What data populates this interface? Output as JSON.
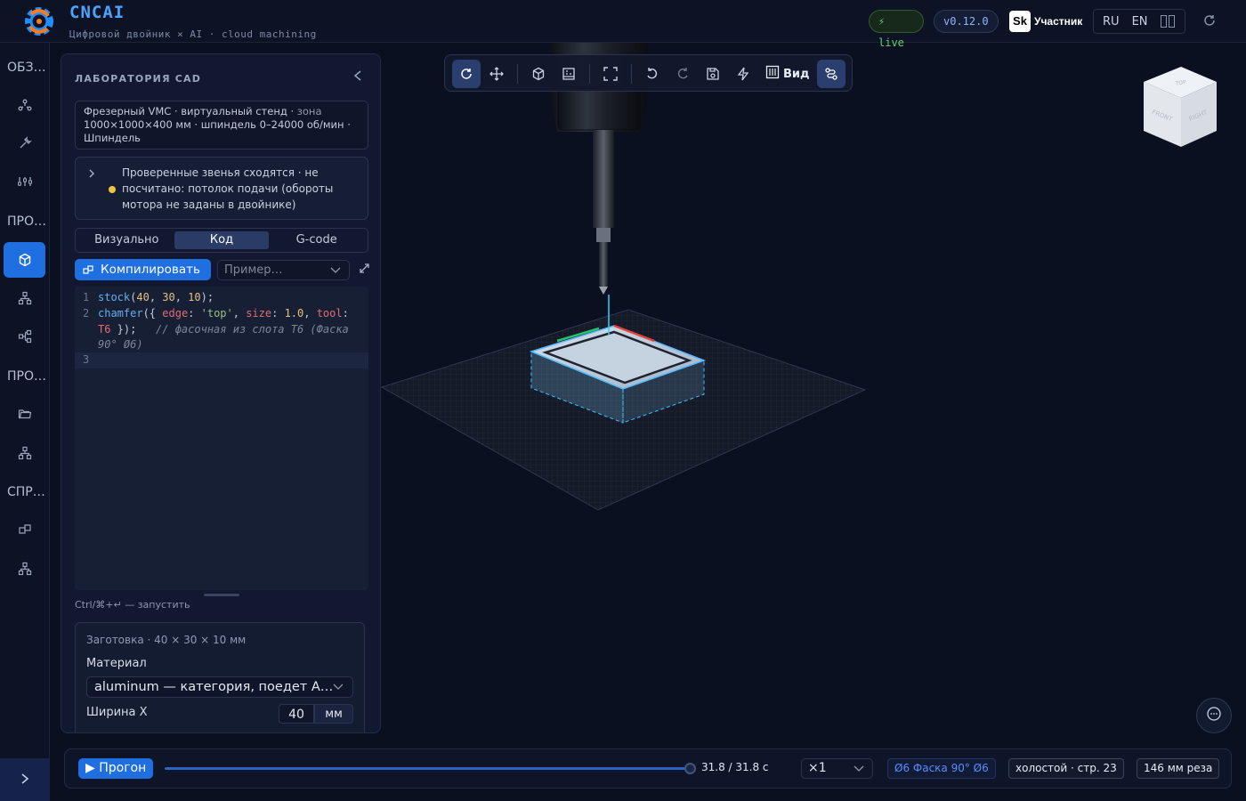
{
  "header": {
    "brand": "CNCAI",
    "subtitle": "Цифровой двойник × AI · cloud machining",
    "live_badge": "⚡ live",
    "version_badge": "v0.12.0",
    "partner_logo": "Sk",
    "partner_label": "Участник",
    "lang_ru": "RU",
    "lang_en": "EN"
  },
  "rail": {
    "labels": [
      "ОБЗОР",
      "ПРОЕКТЫ",
      "ПРОЕКТЫ",
      "СПРАВКА"
    ],
    "icons": [
      "network-icon",
      "wrench-icon",
      "sliders-icon",
      "cube-icon",
      "hierarchy-icon",
      "graph-icon",
      "folder-icon",
      "hierarchy-icon",
      "layers-icon",
      "hierarchy-icon"
    ]
  },
  "panel": {
    "title": "ЛАБОРАТОРИЯ CAD",
    "machine_line1": "Фрезерный VMC · виртуальный стенд · ",
    "machine_zone": "зона",
    "machine_line2": "1000×1000×400 мм · шпиндель 0–24000 об/мин · ",
    "machine_line3": "Шпиндель",
    "status_text": "Проверенные звенья сходятся · не посчитано: потолок подачи (обороты мотора не заданы в двойнике)",
    "tabs": [
      "Визуально",
      "Код",
      "G-code"
    ],
    "active_tab": "Код",
    "compile_label": "Компилировать",
    "example_placeholder": "Пример…",
    "code": {
      "l1_fn": "stock",
      "l1_args_a": "40",
      "l1_args_b": "30",
      "l1_args_c": "10",
      "l2_fn": "chamfer",
      "l2_key1": "edge",
      "l2_str": "'top'",
      "l2_key2": "size",
      "l2_num": "1.0",
      "l2_key3": "tool",
      "l2_tool": "T6",
      "l2_comment": "// фасочная из слота T6 (Фаска 90° Ø6)"
    },
    "hint": "Ctrl/⌘+↵ — запустить",
    "stock_caption": "Заготовка · 40 × 30 × 10 мм",
    "material_label": "Материал",
    "material_value": "aluminum — категория, поедет А…",
    "width_label": "Ширина X",
    "width_value": "40",
    "width_unit": "мм"
  },
  "toolbar": {
    "view_label": "Вид"
  },
  "viewcube": {
    "top": "TOP",
    "front": "FRONT",
    "right": "RIGHT"
  },
  "bottom": {
    "run_label": "▶ Прогон",
    "progress_fraction": 1.0,
    "time_readout": "31.8 / 31.8 с",
    "speed": "×1",
    "tool_chip": "Ø6 Фаска 90° Ø6",
    "idle_chip": "холостой · стр. 23",
    "cut_chip": "146 мм реза"
  },
  "colors": {
    "accent": "#1f6fe0",
    "brand": "#4aa3ff",
    "live": "#62d26b",
    "warning": "#f0c33c",
    "background": "#0b1020"
  }
}
